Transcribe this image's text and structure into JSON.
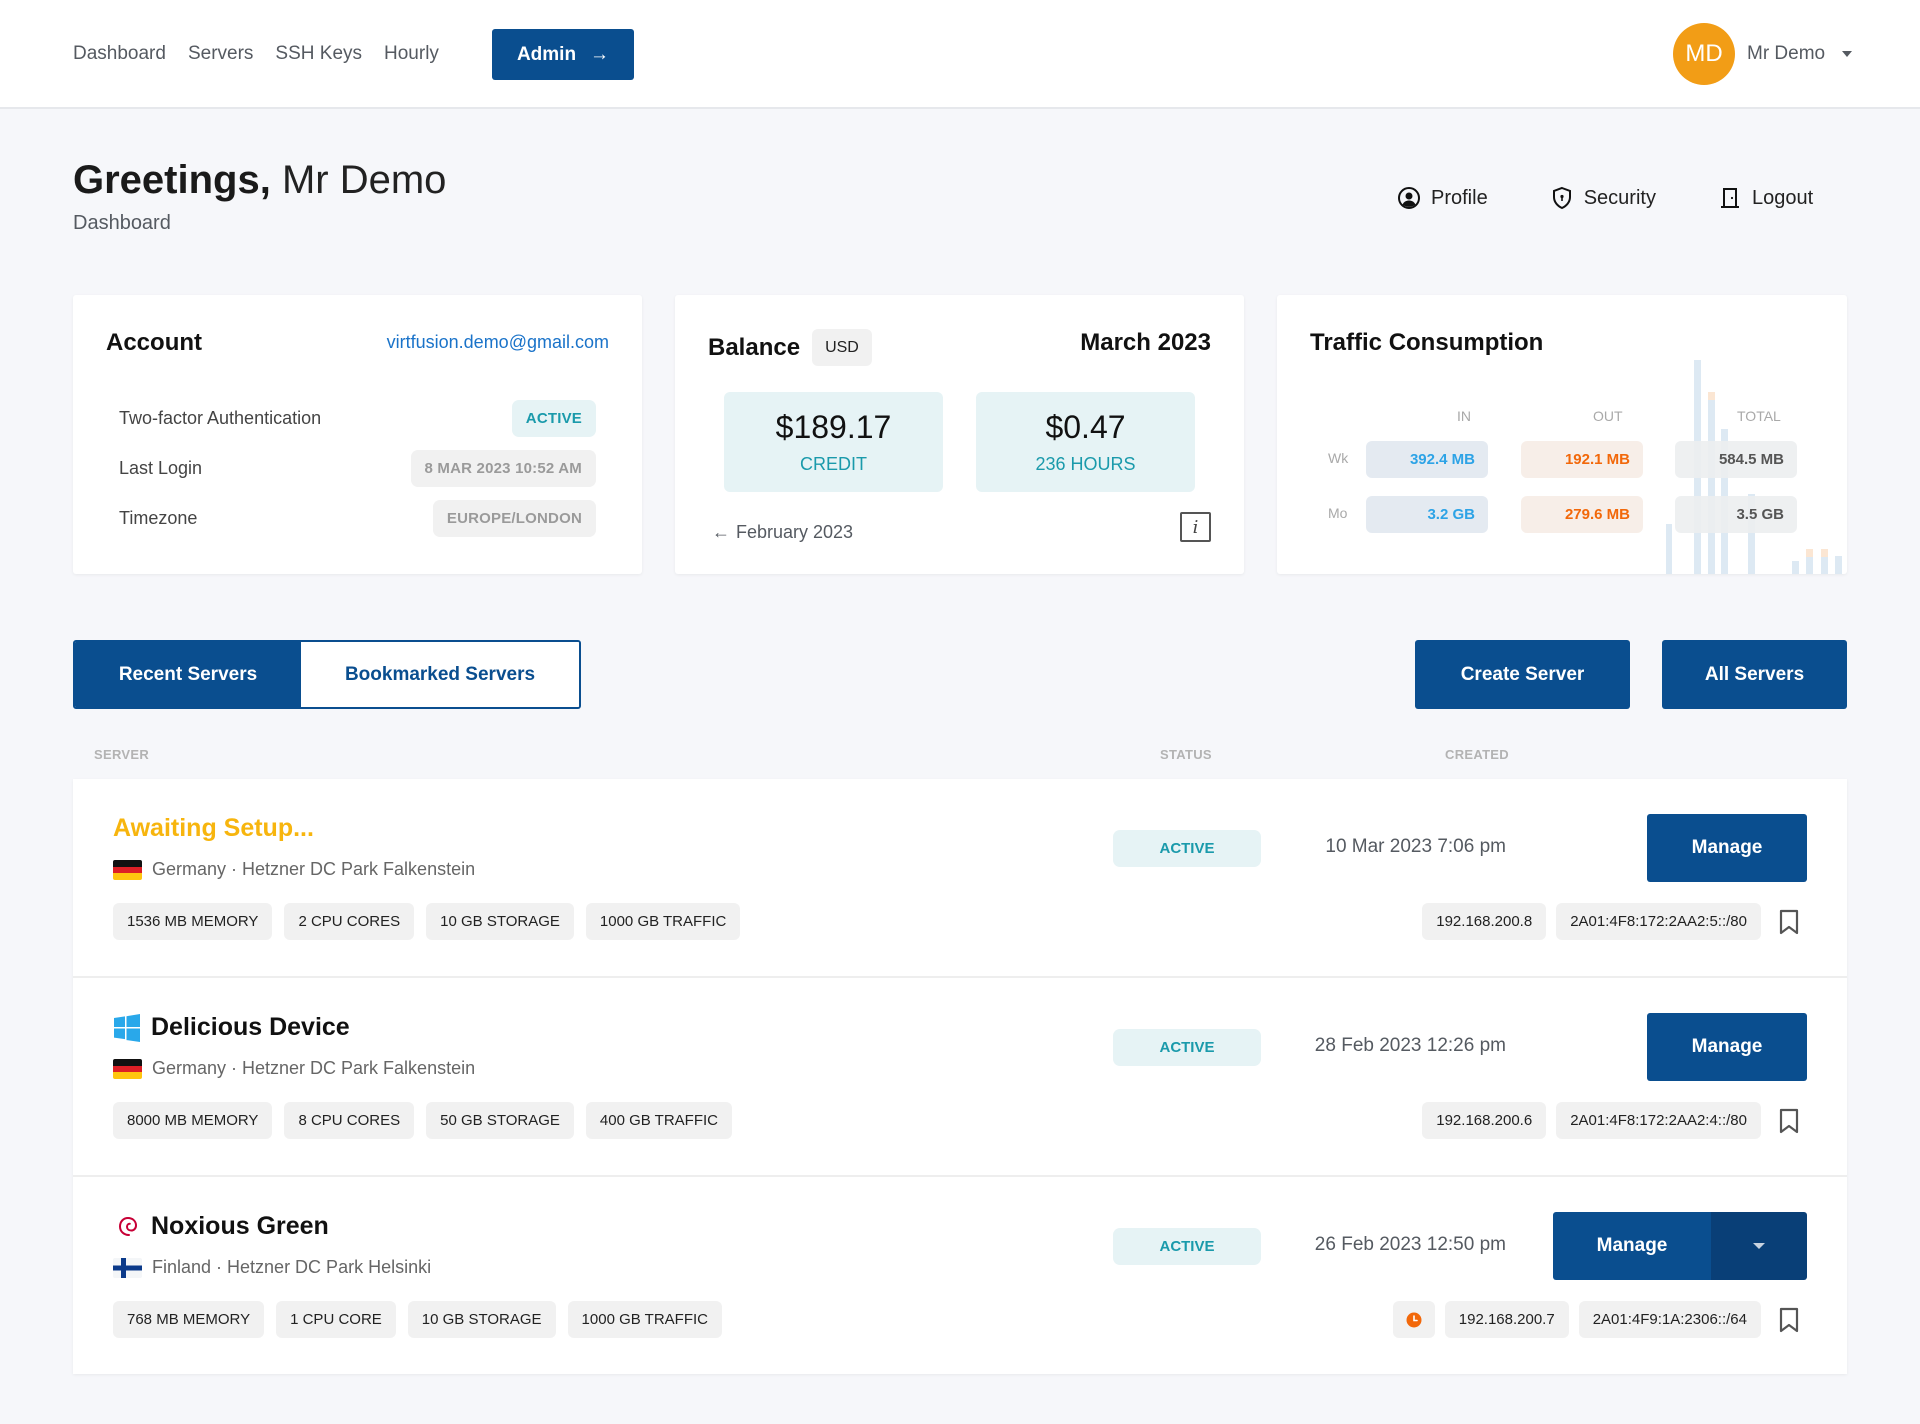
{
  "nav": {
    "links": [
      "Dashboard",
      "Servers",
      "SSH Keys",
      "Hourly"
    ],
    "admin_label": "Admin",
    "admin_icon": "arrow-right-icon"
  },
  "user": {
    "initials": "MD",
    "name": "Mr Demo",
    "avatar_color": "#f29d16"
  },
  "header": {
    "greeting": "Greetings,",
    "name": "Mr Demo",
    "subtitle": "Dashboard",
    "links": [
      {
        "label": "Profile",
        "icon": "user-circle-icon"
      },
      {
        "label": "Security",
        "icon": "shield-lock-icon"
      },
      {
        "label": "Logout",
        "icon": "door-icon"
      }
    ]
  },
  "account": {
    "title": "Account",
    "email": "virtfusion.demo@gmail.com",
    "rows": [
      {
        "label": "Two-factor Authentication",
        "value": "ACTIVE"
      },
      {
        "label": "Last Login",
        "value": "8 MAR 2023 10:52 AM"
      },
      {
        "label": "Timezone",
        "value": "EUROPE/LONDON"
      }
    ]
  },
  "balance": {
    "title": "Balance",
    "currency": "USD",
    "month": "March 2023",
    "credit_amount": "$189.17",
    "credit_label": "CREDIT",
    "usage_amount": "$0.47",
    "usage_label": "236 HOURS",
    "prev_month": "February 2023",
    "info_icon": "info-icon"
  },
  "traffic": {
    "title": "Traffic Consumption",
    "columns": [
      "IN",
      "OUT",
      "TOTAL"
    ],
    "rows": [
      {
        "label": "Wk",
        "in": "392.4 MB",
        "out": "192.1 MB",
        "total": "584.5 MB"
      },
      {
        "label": "Mo",
        "in": "3.2 GB",
        "out": "279.6 MB",
        "total": "3.5 GB"
      }
    ],
    "colors": {
      "in": "#2da3e6",
      "out": "#f2680a"
    }
  },
  "tabs": {
    "recent": "Recent Servers",
    "bookmarked": "Bookmarked Servers",
    "active": "recent"
  },
  "actions": {
    "create": "Create Server",
    "all": "All Servers"
  },
  "columns": {
    "server": "SERVER",
    "status": "STATUS",
    "created": "CREATED"
  },
  "servers": [
    {
      "name": "Awaiting Setup...",
      "os_icon": "",
      "location": "Germany · Hetzner DC Park Falkenstein",
      "flag": "germany-flag-icon",
      "specs": [
        "1536 MB MEMORY",
        "2 CPU CORES",
        "10 GB STORAGE",
        "1000 GB TRAFFIC"
      ],
      "status": "ACTIVE",
      "created": "10 Mar 2023 7:06 pm",
      "manage": "Manage",
      "ipv4": "192.168.200.8",
      "ipv6": "2A01:4F8:172:2AA2:5::/80"
    },
    {
      "name": "Delicious Device",
      "os_icon": "windows-icon",
      "location": "Germany · Hetzner DC Park Falkenstein",
      "flag": "germany-flag-icon",
      "specs": [
        "8000 MB MEMORY",
        "8 CPU CORES",
        "50 GB STORAGE",
        "400 GB TRAFFIC"
      ],
      "status": "ACTIVE",
      "created": "28 Feb 2023 12:26 pm",
      "manage": "Manage",
      "ipv4": "192.168.200.6",
      "ipv6": "2A01:4F8:172:2AA2:4::/80"
    },
    {
      "name": "Noxious Green",
      "os_icon": "debian-icon",
      "location": "Finland · Hetzner DC Park Helsinki",
      "flag": "finland-flag-icon",
      "specs": [
        "768 MB MEMORY",
        "1 CPU CORE",
        "10 GB STORAGE",
        "1000 GB TRAFFIC"
      ],
      "status": "ACTIVE",
      "created": "26 Feb 2023 12:50 pm",
      "manage": "Manage",
      "ipv4": "192.168.200.7",
      "ipv6": "2A01:4F9:1A:2306::/64",
      "hourly_icon": "clock-icon"
    }
  ]
}
